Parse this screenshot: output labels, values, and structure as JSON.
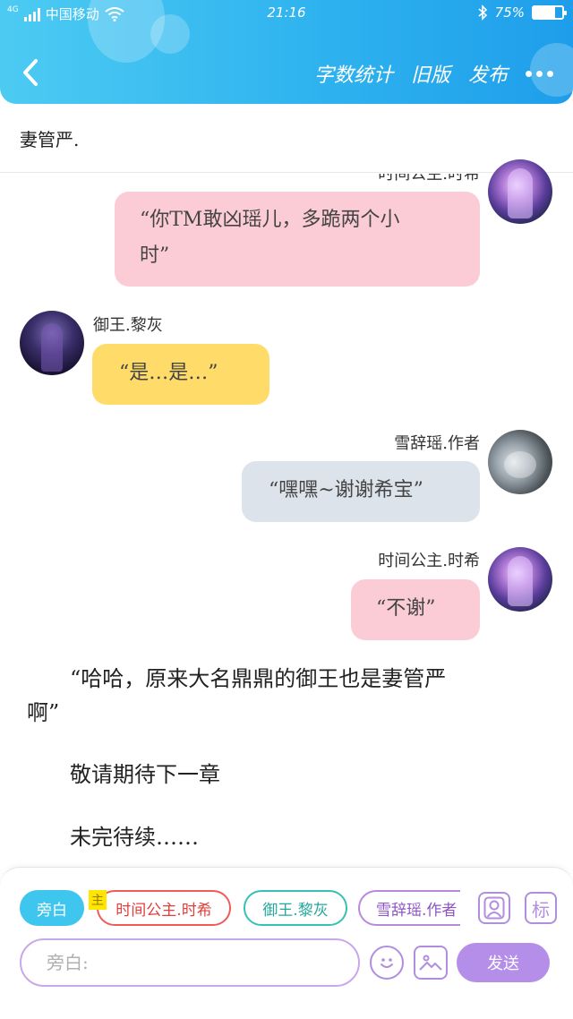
{
  "status_bar": {
    "network_tag": "4G",
    "carrier": "中国移动",
    "time": "21:16",
    "battery_text": "75%",
    "battery_level": 0.75
  },
  "nav": {
    "word_count": "字数统计",
    "old_version": "旧版",
    "publish": "发布"
  },
  "story": {
    "first_line": "妻管严.",
    "messages": [
      {
        "speaker": "时间公主.时希",
        "text": "“你TM敢凶瑶儿，多跪两个小时”",
        "line1": "“你TM敢凶瑶儿，多跪两个小",
        "line2": "时”",
        "side": "right",
        "color": "#fcccd6"
      },
      {
        "speaker": "御王.黎灰",
        "text": "“是…是…”",
        "side": "left",
        "color": "#ffdc6a"
      },
      {
        "speaker": "雪辞瑶.作者",
        "text": "“嘿嘿~谢谢希宝”",
        "side": "right",
        "color": "#dde3ea"
      },
      {
        "speaker": "时间公主.时希",
        "text": "“不谢”",
        "side": "right",
        "color": "#fcccd6"
      }
    ],
    "narration_1_line1": "“哈哈，原来大名鼎鼎的御王也是妻管严",
    "narration_1_line2": "啊”",
    "narration_2": "敬请期待下一章",
    "narration_3": "未完待续……"
  },
  "composer": {
    "chips": {
      "narration": "旁白",
      "main_tag": "主",
      "time_princess": "时间公主.时希",
      "lord": "御王.黎灰",
      "author": "雪辞瑶.作者"
    },
    "mark_button": "标",
    "input_placeholder": "旁白:",
    "input_value": "",
    "send": "发送"
  }
}
